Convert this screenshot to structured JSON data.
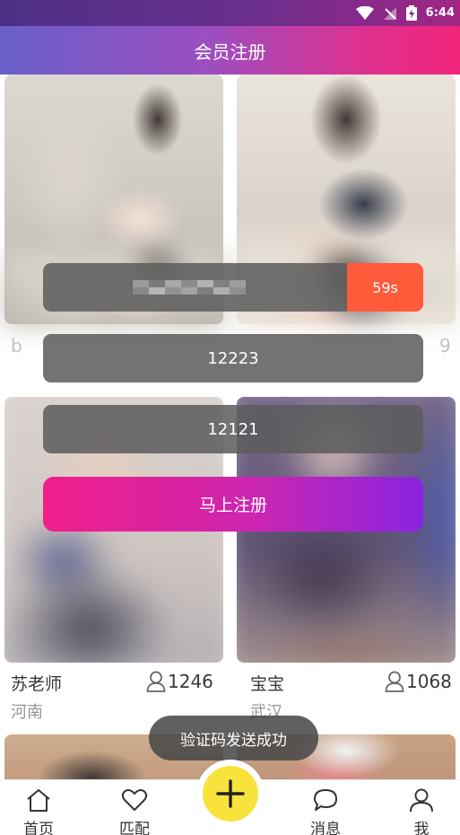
{
  "status_bar": {
    "time": "6:44"
  },
  "header": {
    "title": "会员注册"
  },
  "background": {
    "partial_left": "b",
    "partial_right": "9",
    "cards": [
      {
        "name": "苏老师",
        "city": "河南",
        "count": "1246"
      },
      {
        "name": "宝宝",
        "city": "武汉",
        "count": "1068"
      }
    ]
  },
  "form": {
    "countdown_label": "59s",
    "code_value": "12223",
    "password_value": "12121",
    "submit_label": "马上注册"
  },
  "toast": {
    "message": "验证码发送成功"
  },
  "nav": {
    "items": [
      {
        "label": "首页",
        "icon": "home-icon"
      },
      {
        "label": "匹配",
        "icon": "heart-icon"
      },
      {
        "label": "",
        "icon": "plus-icon"
      },
      {
        "label": "消息",
        "icon": "chat-icon"
      },
      {
        "label": "我",
        "icon": "user-icon"
      }
    ]
  },
  "colors": {
    "countdown_button": "#ff5a3a",
    "fab": "#f7e33c",
    "submit_start": "#f01f8a",
    "submit_end": "#8a24e0"
  }
}
